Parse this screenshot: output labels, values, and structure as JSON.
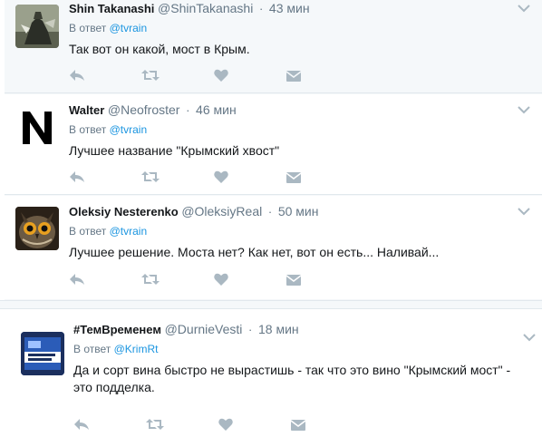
{
  "colors": {
    "link": "#1b95e0",
    "muted": "#657786",
    "icon": "#aab8c2",
    "bg_highlight": "#f5f8fa"
  },
  "tweets": [
    {
      "fullname": "Shin Takanashi",
      "username": "@ShinTakanashi",
      "time": "43 мин",
      "reply_prefix": "В ответ",
      "reply_to": "@tvrain",
      "text": "Так вот он какой, мост в Крым.",
      "avatar": "dark-warrior-artwork"
    },
    {
      "fullname": "Walter",
      "username": "@Neofroster",
      "time": "46 мин",
      "reply_prefix": "В ответ",
      "reply_to": "@tvrain",
      "text": "Лучшее название \"Крымский хвост\"",
      "avatar": "N"
    },
    {
      "fullname": "Oleksiy Nesterenko",
      "username": "@OleksiyReal",
      "time": "50 мин",
      "reply_prefix": "В ответ",
      "reply_to": "@tvrain",
      "text": "Лучшее решение. Моста нет? Как нет, вот он есть... Наливай...",
      "avatar": "owl-photo"
    },
    {
      "fullname": "#ТемВременем",
      "username": "@DurnieVesti",
      "time": "18 мин",
      "reply_prefix": "В ответ",
      "reply_to": "@KrimRt",
      "text": "Да и сорт вина быстро не вырастишь - так что это вино \"Крымский мост\" - это подделка.",
      "avatar": "cigarette-pack-photo"
    }
  ],
  "icons": [
    "reply-icon",
    "retweet-icon",
    "like-icon",
    "message-icon",
    "chevron-down-icon"
  ]
}
